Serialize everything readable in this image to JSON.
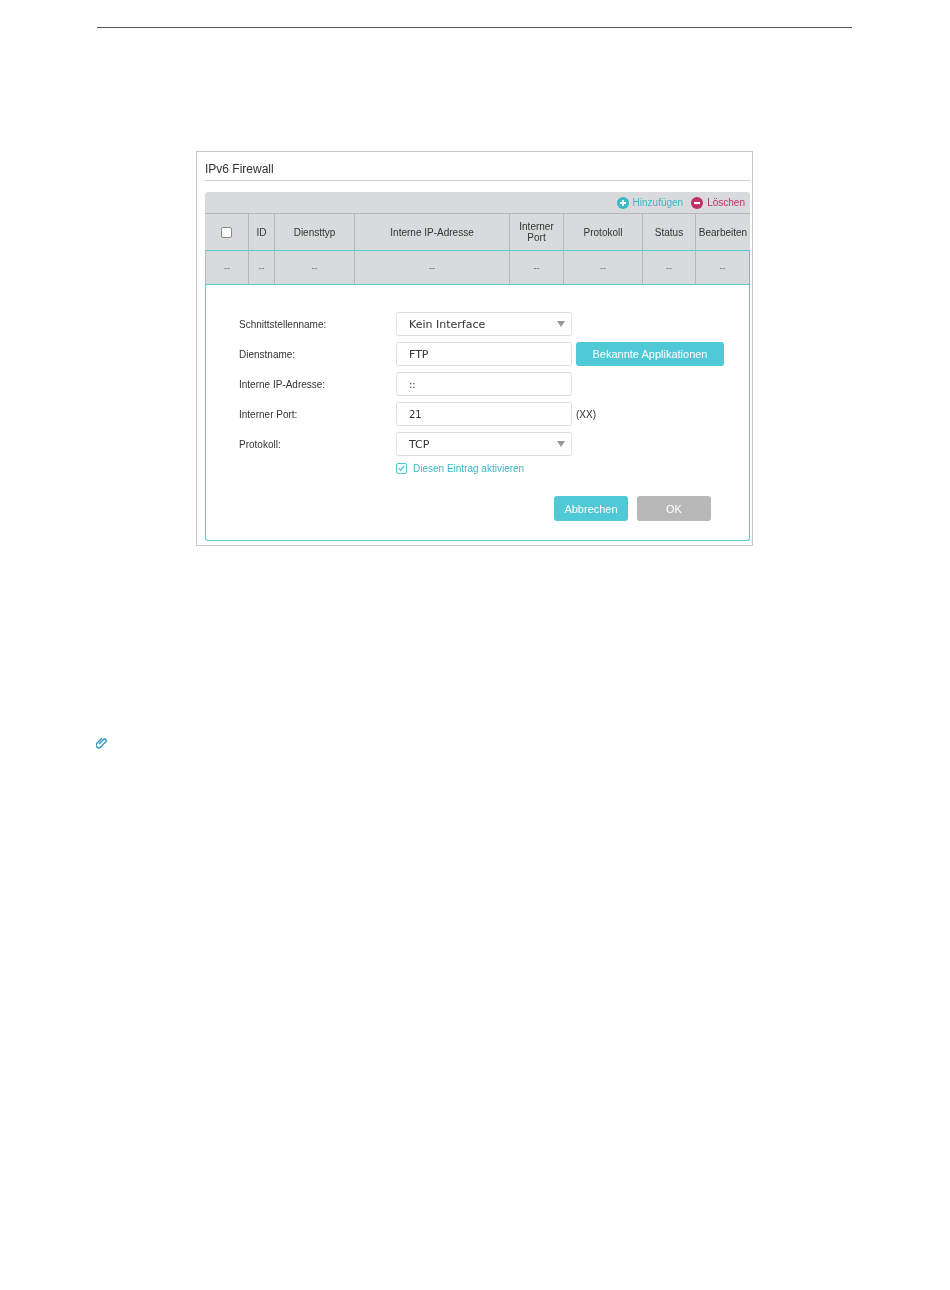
{
  "panel": {
    "title": "IPv6 Firewall",
    "actions": [
      {
        "kind": "add",
        "label": "Hinzufügen"
      },
      {
        "kind": "delete",
        "label": "Löschen"
      }
    ],
    "table": {
      "select_all": {
        "checked": false
      },
      "columns": [
        "ID",
        "Diensttyp",
        "Interne IP-Adresse",
        "Interner Port",
        "Protokoll",
        "Status",
        "Bearbeiten"
      ],
      "rows": [
        {
          "checkbox_cell": "--",
          "cells": [
            "--",
            "--",
            "--",
            "--",
            "--",
            "--",
            "--"
          ]
        }
      ]
    },
    "form": {
      "fields": [
        {
          "kind": "select",
          "label": "Schnittstellenname:",
          "value": "Kein Interface"
        },
        {
          "kind": "text",
          "label": "Dienstname:",
          "value": "FTP",
          "button": "Bekannte Applikationen"
        },
        {
          "kind": "text",
          "label": "Interne IP-Adresse:",
          "value": "::"
        },
        {
          "kind": "text",
          "label": "Interner Port:",
          "value": "21",
          "suffix": "(XX)"
        },
        {
          "kind": "select",
          "label": "Protokoll:",
          "value": "TCP"
        }
      ],
      "enable": {
        "label": "Diesen Eintrag aktivieren",
        "checked": true
      },
      "buttons": [
        {
          "kind": "primary",
          "label": "Abbrechen"
        },
        {
          "kind": "disabled",
          "label": "OK"
        }
      ]
    }
  }
}
